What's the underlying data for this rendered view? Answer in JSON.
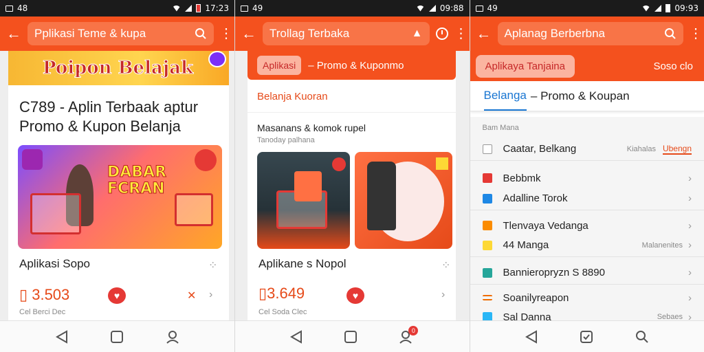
{
  "screens": [
    {
      "status": {
        "time": "17:23"
      },
      "search": {
        "text": "Pplikasi Teme & kupa"
      },
      "banner": {
        "text": "Poipon Belajak"
      },
      "card": {
        "title": "C789 - Aplin Terbaak aptur Promo & Kupon Belanja",
        "promo_badge": "DABAR FCRAN",
        "item_name": "Aplikasi Sopo",
        "price": "3.503",
        "small": "Cel Berci Dec"
      }
    },
    {
      "status": {
        "time": "09:88"
      },
      "search": {
        "text": "Trollag Terbaka"
      },
      "topbar": {
        "pill": "Aplikasi",
        "text": "– Promo & Kuponmo"
      },
      "section": "Belanja Kuoran",
      "subtitle": "Masanans & komok rupel",
      "subtitle2": "Tanoday palhana",
      "item_name": "Aplikane s Nopol",
      "price": "3.649",
      "small": "Cel Soda Clec",
      "badge_count": "0"
    },
    {
      "status": {
        "time": "09:93"
      },
      "search": {
        "text": "Aplanag Berberbna"
      },
      "topbar": {
        "pill": "Aplikaya Tanjaina",
        "right": "Soso clo"
      },
      "tabs": {
        "active": "Belanga",
        "rest": "– Promo & Koupan"
      },
      "header_label": "Bam Mana",
      "rows": [
        {
          "label": "Caatar, Belkang",
          "value": "Kiahalas",
          "value2": "Ubengn",
          "color": "#9e9e9e"
        },
        {
          "label": "Bebbmk",
          "value": "",
          "color": "#e53935"
        },
        {
          "label": "Adalline Torok",
          "value": "",
          "color": "#1e88e5"
        },
        {
          "label": "Tlenvaya Vedanga",
          "value": "",
          "color": "#fb8c00"
        },
        {
          "label": "44 Manga",
          "value": "Malanenites",
          "color": "#fdd835"
        },
        {
          "label": "Bannieropryzn S 8890",
          "value": "",
          "color": "#26a69a"
        },
        {
          "label": "Soanilyreapon",
          "value": "",
          "color": "#ef6c00"
        },
        {
          "label": "Sal Danna",
          "value": "Sebaes",
          "color": "#29b6f6"
        }
      ]
    }
  ]
}
